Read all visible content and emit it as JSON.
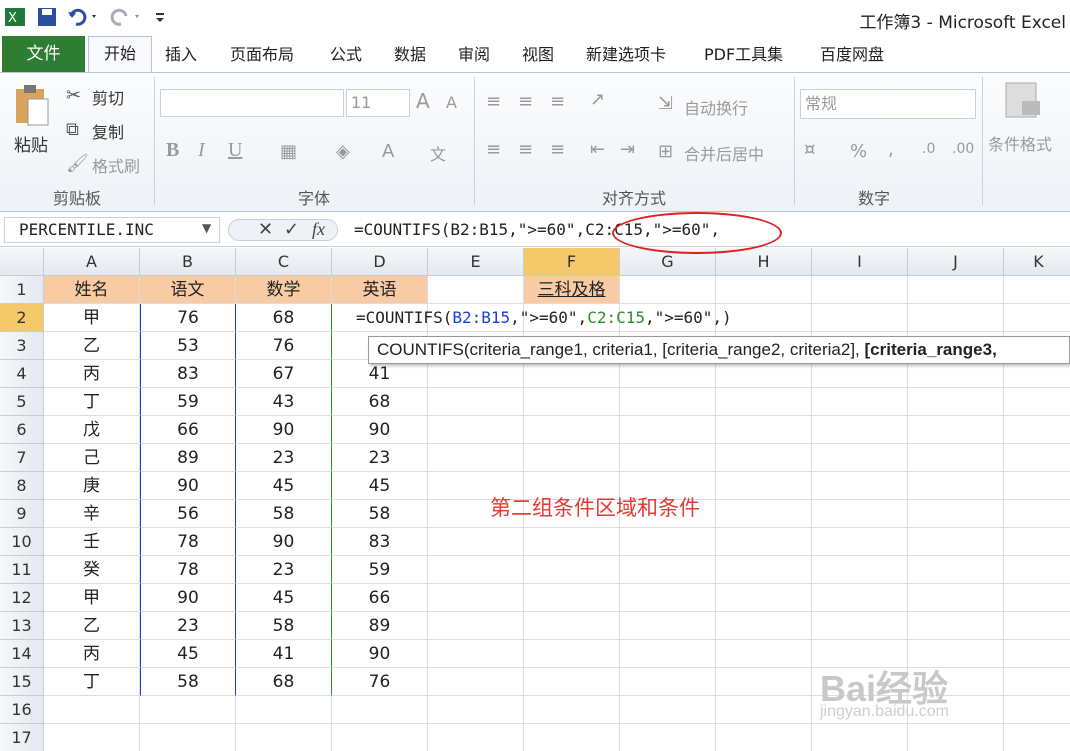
{
  "title": {
    "app_title": "工作簿3 - Microsoft Excel"
  },
  "menu": {
    "file": "文件",
    "tabs": [
      "开始",
      "插入",
      "页面布局",
      "公式",
      "数据",
      "审阅",
      "视图",
      "新建选项卡",
      "PDF工具集",
      "百度网盘"
    ]
  },
  "ribbon": {
    "clipboard": {
      "paste": "粘贴",
      "cut": "剪切",
      "copy": "复制",
      "format_painter": "格式刷",
      "label": "剪贴板"
    },
    "font": {
      "size": "11",
      "bold": "B",
      "italic": "I",
      "underline": "U",
      "label": "字体"
    },
    "alignment": {
      "wrap_text": "自动换行",
      "merge_center": "合并后居中",
      "label": "对齐方式"
    },
    "number": {
      "format": "常规",
      "percent": "%",
      "comma": ",",
      "label": "数字"
    },
    "styles": {
      "conditional_format": "条件格式"
    }
  },
  "formula_bar": {
    "name_box": "PERCENTILE.INC",
    "formula": "=COUNTIFS(B2:B15,\">=60\",C2:C15,\">=60\","
  },
  "grid": {
    "columns": [
      "A",
      "B",
      "C",
      "D",
      "E",
      "F",
      "G",
      "H",
      "I",
      "J",
      "K"
    ],
    "rows": [
      "1",
      "2",
      "3",
      "4",
      "5",
      "6",
      "7",
      "8",
      "9",
      "10",
      "11",
      "12",
      "13",
      "14",
      "15",
      "16",
      "17"
    ],
    "header_row": [
      "姓名",
      "语文",
      "数学",
      "英语"
    ],
    "f1": "三科及格",
    "data": [
      [
        "甲",
        "76",
        "68",
        ""
      ],
      [
        "乙",
        "53",
        "76",
        ""
      ],
      [
        "丙",
        "83",
        "67",
        "41"
      ],
      [
        "丁",
        "59",
        "43",
        "68"
      ],
      [
        "戊",
        "66",
        "90",
        "90"
      ],
      [
        "己",
        "89",
        "23",
        "23"
      ],
      [
        "庚",
        "90",
        "45",
        "45"
      ],
      [
        "辛",
        "56",
        "58",
        "58"
      ],
      [
        "壬",
        "78",
        "90",
        "83"
      ],
      [
        "癸",
        "78",
        "23",
        "59"
      ],
      [
        "甲",
        "90",
        "45",
        "66"
      ],
      [
        "乙",
        "23",
        "58",
        "89"
      ],
      [
        "丙",
        "45",
        "41",
        "90"
      ],
      [
        "丁",
        "58",
        "68",
        "76"
      ]
    ],
    "d2_editing": {
      "p1": "=COUNTIFS(",
      "p2": "B2:B15",
      "p3": ",\">=60\",",
      "p4": "C2:C15",
      "p5": ",\">=60\",)"
    }
  },
  "tooltip": {
    "normal": "COUNTIFS(criteria_range1, criteria1, [criteria_range2, criteria2], ",
    "bold": "[criteria_range3,"
  },
  "annotation": "第二组条件区域和条件",
  "watermark": {
    "main": "Bai经验",
    "sub": "jingyan.baidu.com"
  },
  "colors": {
    "file_tab": "#2e7d32",
    "header_fill": "#f8cba4",
    "annotation": "#e53935",
    "range1": "#1a3fd0",
    "range2": "#2e8b2e"
  }
}
